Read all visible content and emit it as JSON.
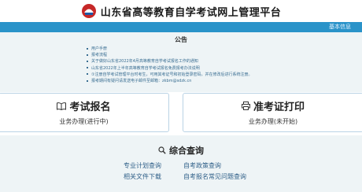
{
  "header": {
    "site_title": "山东省高等教育自学考试网上管理平台",
    "logo_icon": "emblem-logo-icon"
  },
  "navbar": {
    "color": "#2a93c9",
    "right_link": "基本信息"
  },
  "notice": {
    "title": "公告",
    "items": [
      "用户手册",
      "报考流程",
      "关于做好山东省2022年4月高等教育自学考试报名工作的通知",
      "山东省2022年上半年高等教育自学考试报名免费报考办法说明",
      "①注册自学考试管理平台时考生，可用其考证号和初始登录密码，并在修改后进行系统注册。",
      "报考期间有疑问请发送电子邮件至邮箱：zkbm@sdzk.cn"
    ]
  },
  "cards": {
    "exam_signup": {
      "title": "考试报名",
      "status": "业务办理(进行中)",
      "icon": "open-book-icon"
    },
    "admission_print": {
      "title": "准考证打印",
      "status": "业务办理(未开始)",
      "icon": "print-icon"
    }
  },
  "query": {
    "title": "综合查询",
    "icon": "search-icon",
    "links": [
      "专业计划查询",
      "自考政策查询",
      "相关文件下载",
      "自考报名常见问题查询"
    ]
  }
}
